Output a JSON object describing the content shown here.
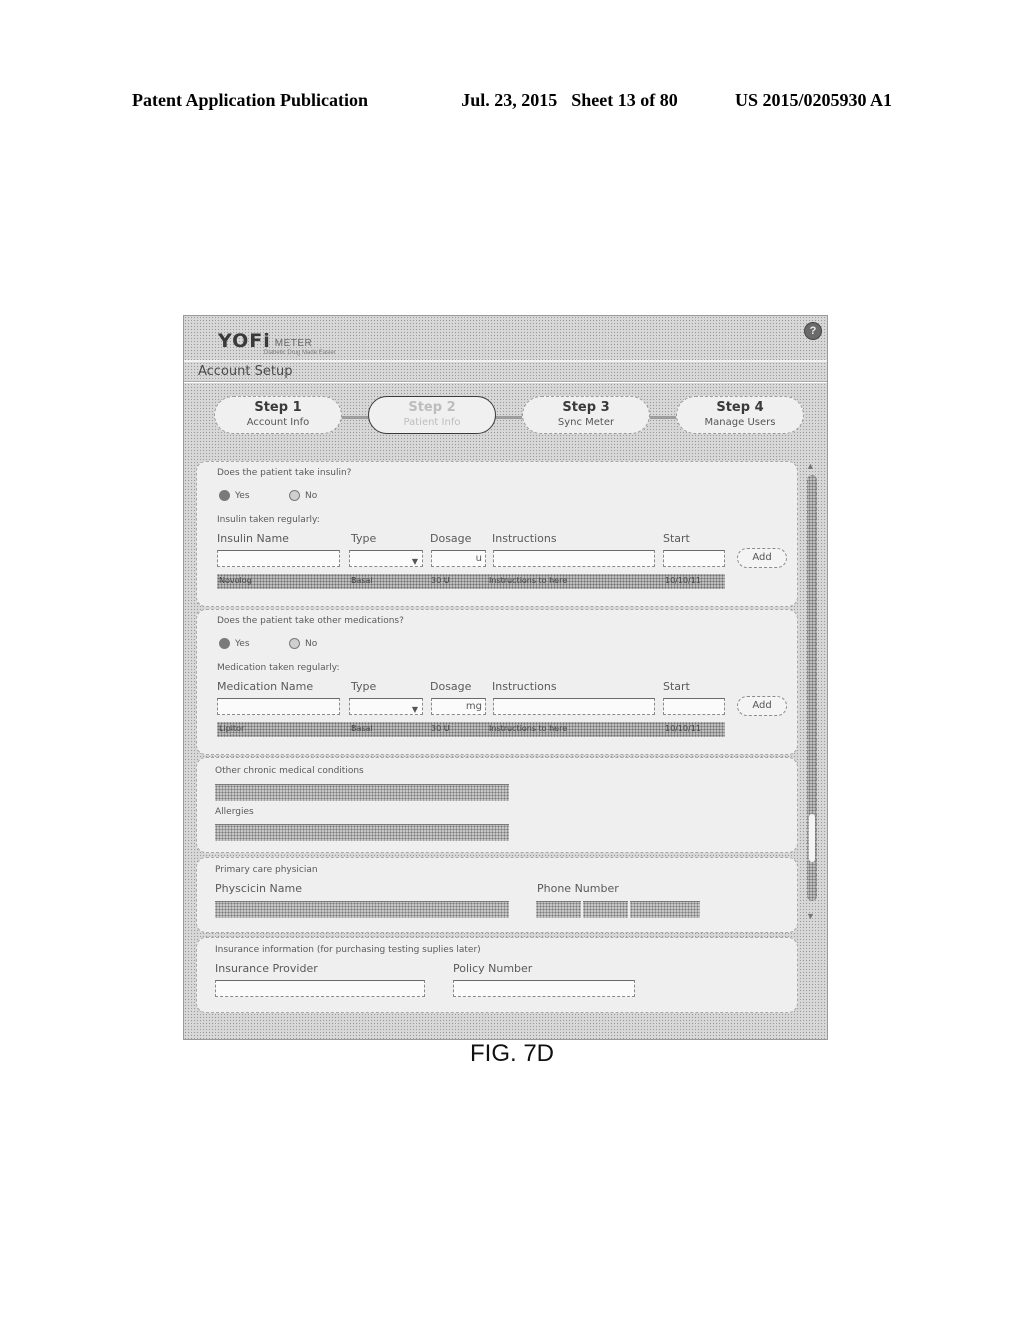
{
  "patent_header": {
    "publication": "Patent Application Publication",
    "date": "Jul. 23, 2015",
    "sheet": "Sheet 13 of 80",
    "number": "US 2015/0205930 A1"
  },
  "figure_caption": "FIG. 7D",
  "app": {
    "logo_main": "YOFi",
    "logo_sub": "METER",
    "logo_tagline": "Diabetic Drug Made Easier",
    "help_icon": "?",
    "section_title": "Account Setup"
  },
  "steps": [
    {
      "number": "Step 1",
      "name": "Account Info",
      "active": false
    },
    {
      "number": "Step 2",
      "name": "Patient Info",
      "active": true
    },
    {
      "number": "Step 3",
      "name": "Sync Meter",
      "active": false
    },
    {
      "number": "Step 4",
      "name": "Manage Users",
      "active": false
    }
  ],
  "insulin": {
    "question": "Does the patient take insulin?",
    "yes_label": "Yes",
    "no_label": "No",
    "selected": "Yes",
    "subheading": "Insulin taken regularly:",
    "columns": {
      "name": "Insulin Name",
      "type": "Type",
      "dosage": "Dosage",
      "instructions": "Instructions",
      "start": "Start"
    },
    "inputs": {
      "name": "",
      "type": "",
      "dosage_unit": "u",
      "instructions": "",
      "start": ""
    },
    "add_label": "Add",
    "rows": [
      {
        "name": "Novolog",
        "type": "Basal",
        "dosage": "30 U",
        "instructions": "Instructions to here",
        "start": "10/10/11"
      }
    ]
  },
  "medications": {
    "question": "Does the patient take other medications?",
    "yes_label": "Yes",
    "no_label": "No",
    "selected": "Yes",
    "subheading": "Medication taken regularly:",
    "columns": {
      "name": "Medication Name",
      "type": "Type",
      "dosage": "Dosage",
      "instructions": "Instructions",
      "start": "Start"
    },
    "inputs": {
      "name": "",
      "type": "",
      "dosage_unit": "mg",
      "instructions": "",
      "start": ""
    },
    "add_label": "Add",
    "rows": [
      {
        "name": "Lipitor",
        "type": "Basal",
        "dosage": "30 U",
        "instructions": "Instructions to here",
        "start": "10/10/11"
      }
    ]
  },
  "conditions": {
    "chronic_label": "Other chronic medical conditions",
    "chronic_value": "",
    "allergies_label": "Allergies",
    "allergies_value": ""
  },
  "physician": {
    "heading": "Primary care physician",
    "name_label": "Physcicin Name",
    "name_value": "",
    "phone_label": "Phone Number",
    "phone_parts": [
      "",
      "",
      ""
    ]
  },
  "insurance": {
    "heading": "Insurance information (for purchasing testing suplies later)",
    "provider_label": "Insurance Provider",
    "provider_value": "",
    "policy_label": "Policy Number",
    "policy_value": ""
  },
  "scrollbar": {
    "up_icon": "▲",
    "down_icon": "▼",
    "position": 0.8
  }
}
